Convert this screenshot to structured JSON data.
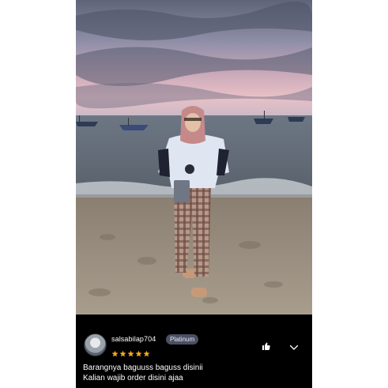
{
  "review": {
    "username": "salsabilap704",
    "badge": "Platinum",
    "rating": 5,
    "comment_lines": [
      "Barangnya baguuss baguss disinii",
      "Kalian wajib order disini ajaa"
    ]
  },
  "colors": {
    "background": "#000000",
    "star": "#f5a623",
    "badge_bg": "#4a4f63",
    "text": "#ffffff"
  },
  "icons": {
    "like": "thumbs-up-icon",
    "expand": "chevron-down-icon"
  }
}
